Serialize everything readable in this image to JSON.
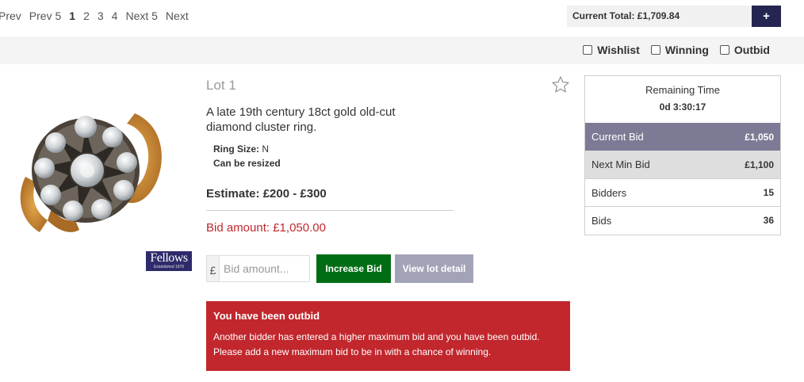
{
  "pagination": {
    "prev": "Prev",
    "prev5": "Prev 5",
    "pages": [
      "1",
      "2",
      "3",
      "4"
    ],
    "current_page": "1",
    "next5": "Next 5",
    "next": "Next"
  },
  "cart": {
    "total_label": "Current Total: £1,709.84",
    "add_label": "+"
  },
  "filters": {
    "wishlist": "Wishlist",
    "winning": "Winning",
    "outbid": "Outbid"
  },
  "lot": {
    "number": "Lot 1",
    "title": "A late 19th century 18ct gold old-cut diamond cluster ring.",
    "ring_size_label": "Ring Size:",
    "ring_size_value": "N",
    "resize_note": "Can be resized",
    "estimate": "Estimate: £200 - £300",
    "bid_amount": "Bid amount: £1,050.00"
  },
  "logo": {
    "text": "Fellows",
    "sub": "Established 1876"
  },
  "bid_form": {
    "currency_symbol": "£",
    "placeholder": "Bid amount...",
    "increase_label": "Increase Bid",
    "view_label": "View lot detail"
  },
  "alert": {
    "title": "You have been outbid",
    "message": "Another bidder has entered a higher maximum bid and you have been outbid. Please add a new maximum bid to be in with a chance of winning."
  },
  "stats": {
    "remaining_label": "Remaining Time",
    "remaining_value": "0d 3:30:17",
    "rows": [
      {
        "label": "Current Bid",
        "value": "£1,050"
      },
      {
        "label": "Next Min Bid",
        "value": "£1,100"
      },
      {
        "label": "Bidders",
        "value": "15"
      },
      {
        "label": "Bids",
        "value": "36"
      }
    ]
  },
  "colors": {
    "outbid_alert": "#c1272d",
    "increase_button": "#006d14",
    "current_bid_row": "#7c7a94",
    "brand_navy": "#252551"
  }
}
